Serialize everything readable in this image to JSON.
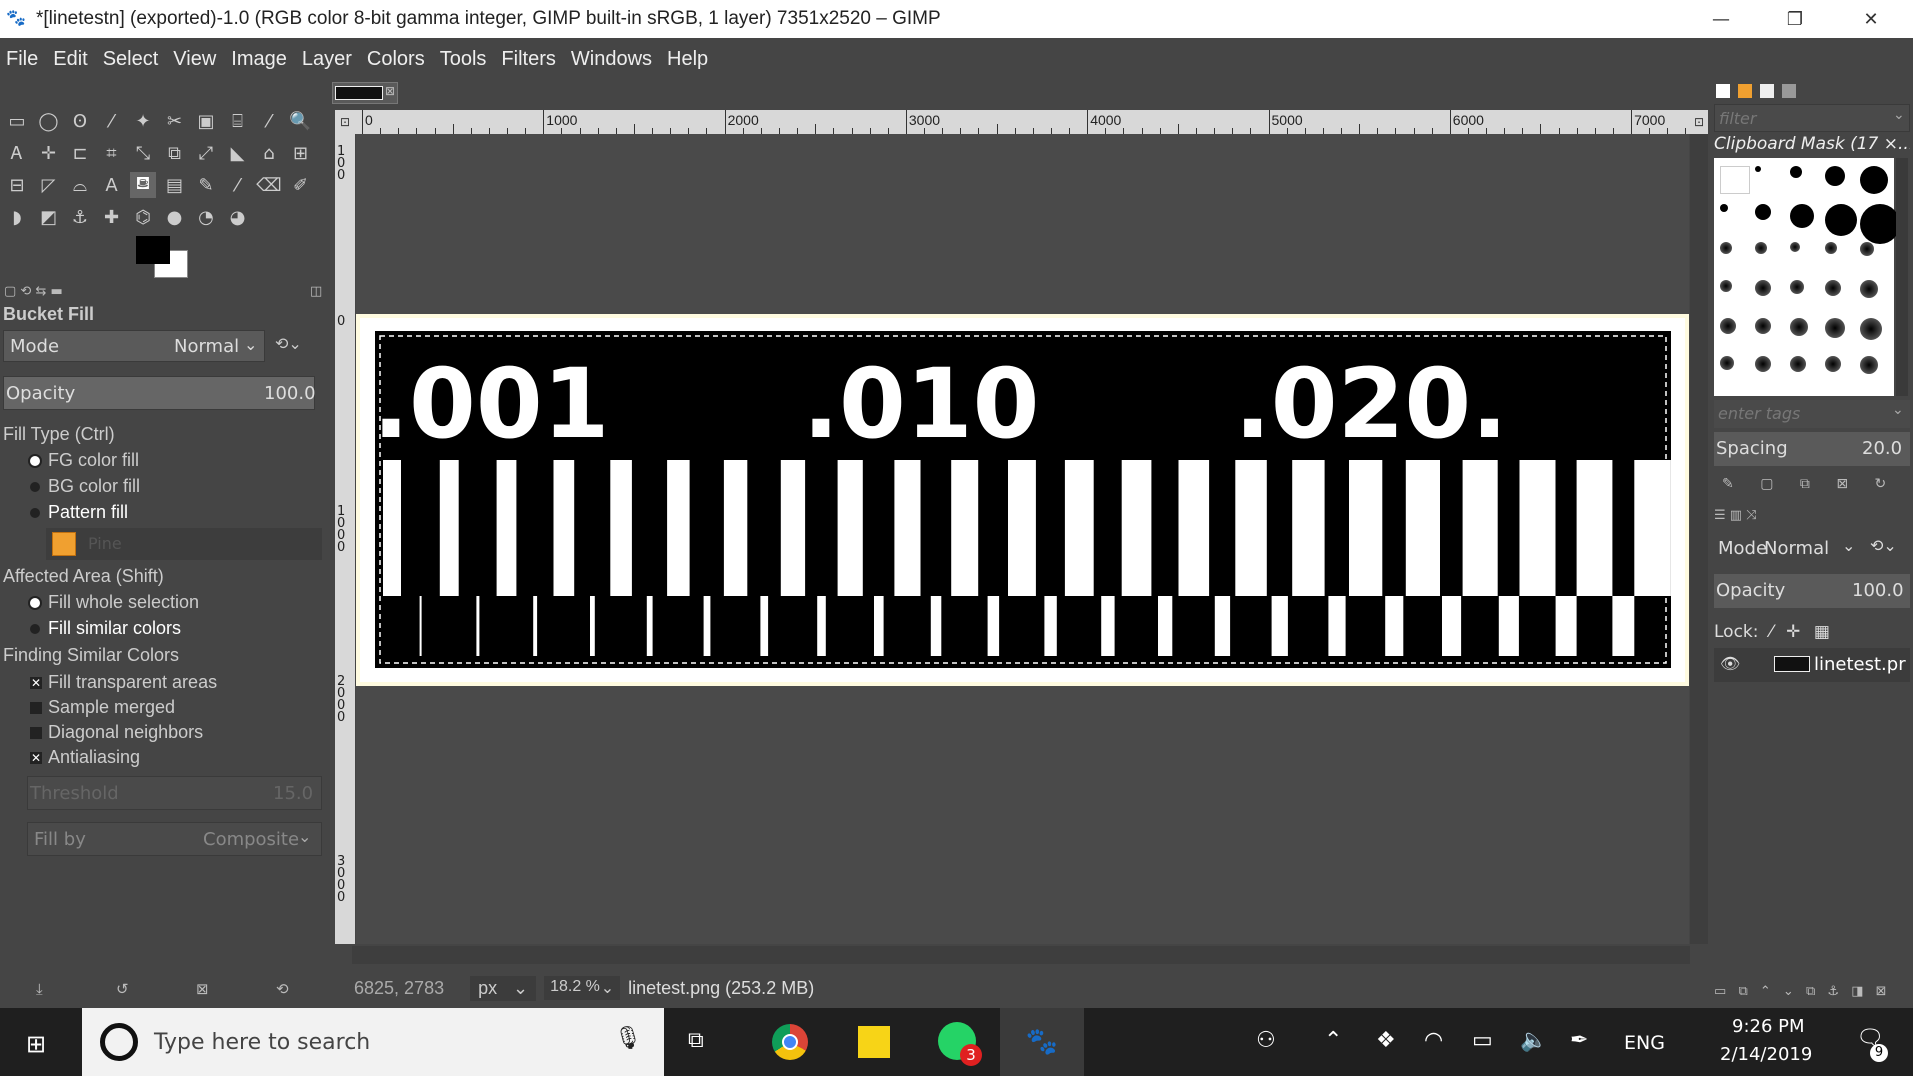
{
  "window": {
    "title": "*[linetestn] (exported)-1.0 (RGB color 8-bit gamma integer, GIMP built-in sRGB, 1 layer) 7351x2520 – GIMP",
    "minimize": "—",
    "restore": "❐",
    "close": "✕"
  },
  "menu": [
    "File",
    "Edit",
    "Select",
    "View",
    "Image",
    "Layer",
    "Colors",
    "Tools",
    "Filters",
    "Windows",
    "Help"
  ],
  "tool_options": {
    "title": "Bucket Fill",
    "mode_label": "Mode",
    "mode_value": "Normal",
    "opacity_label": "Opacity",
    "opacity_value": "100.0",
    "fill_type_label": "Fill Type  (Ctrl)",
    "fill_type_options": [
      "FG color fill",
      "BG color fill",
      "Pattern fill"
    ],
    "pattern_name": "Pine",
    "affected_label": "Affected Area  (Shift)",
    "affected_options": [
      "Fill whole selection",
      "Fill similar colors"
    ],
    "finding_label": "Finding Similar Colors",
    "checks": [
      {
        "label": "Fill transparent areas",
        "checked": true
      },
      {
        "label": "Sample merged",
        "checked": false
      },
      {
        "label": "Diagonal neighbors",
        "checked": false
      },
      {
        "label": "Antialiasing",
        "checked": true
      }
    ],
    "threshold_label": "Threshold",
    "threshold_value": "15.0",
    "fill_by_label": "Fill by",
    "fill_by_value": "Composite"
  },
  "ruler_h_labels": [
    "0",
    "1000",
    "2000",
    "3000",
    "4000",
    "5000",
    "6000",
    "7000"
  ],
  "ruler_v_labels": [
    "100",
    "0",
    "1000",
    "2000",
    "3000"
  ],
  "canvas_labels": [
    ".001",
    ".010",
    ".020."
  ],
  "canvas_bars": {
    "count": 23,
    "dividers": 22
  },
  "right_dock": {
    "filter_placeholder": "filter",
    "brush_title": "Clipboard Mask (17 ×...",
    "tags_placeholder": "enter tags",
    "spacing_label": "Spacing",
    "spacing_value": "20.0",
    "mode_label": "Mode",
    "mode_value": "Normal",
    "opacity_label": "Opacity",
    "opacity_value": "100.0",
    "lock_label": "Lock:",
    "layer_name": "linetest.pr"
  },
  "status": {
    "coords": "6825, 2783",
    "unit": "px",
    "zoom": "18.2 %",
    "file_info": "linetest.png (253.2 MB)"
  },
  "taskbar": {
    "search_placeholder": "Type here to search",
    "whatsapp_badge": "3",
    "lang": "ENG",
    "time": "9:26 PM",
    "date": "2/14/2019",
    "notif_count": "9"
  }
}
